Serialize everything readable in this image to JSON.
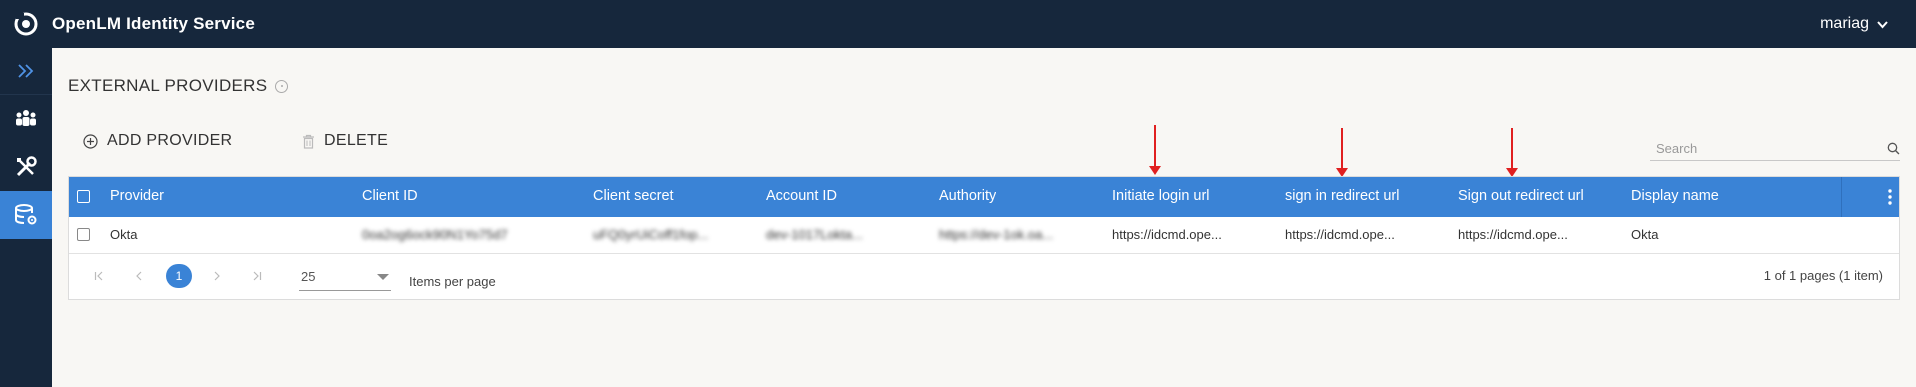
{
  "app": {
    "title": "OpenLM Identity Service",
    "user": "mariag"
  },
  "sidebar": {
    "items": [
      {
        "icon": "double-chevron-right-icon"
      },
      {
        "icon": "users-group-icon"
      },
      {
        "icon": "tools-icon"
      },
      {
        "icon": "database-settings-icon",
        "active": true
      }
    ]
  },
  "page": {
    "title": "EXTERNAL PROVIDERS",
    "add_label": "ADD PROVIDER",
    "delete_label": "DELETE",
    "search_placeholder": "Search"
  },
  "table": {
    "columns": [
      "Provider",
      "Client ID",
      "Client secret",
      "Account ID",
      "Authority",
      "Initiate login url",
      "sign in redirect url",
      "Sign out redirect url",
      "Display name"
    ],
    "rows": [
      {
        "provider": "Okta",
        "client_id": "0oa2og6ock90N1Yo75d7",
        "client_secret": "uFQ0yrUiCoff1fop...",
        "account_id": "dev-1017Lokta...",
        "authority": "https://dev-1ok.oa...",
        "initiate_login_url": "https://idcmd.ope...",
        "sign_in_redirect_url": "https://idcmd.ope...",
        "sign_out_redirect_url": "https://idcmd.ope...",
        "display_name": "Okta"
      }
    ]
  },
  "pagination": {
    "current_page": "1",
    "page_size": "25",
    "items_per_page_label": "Items per page",
    "info": "1 of 1 pages (1 item)"
  },
  "colors": {
    "topbar": "#16273c",
    "accent": "#3a83d6",
    "annotation_arrow": "#e02020"
  }
}
